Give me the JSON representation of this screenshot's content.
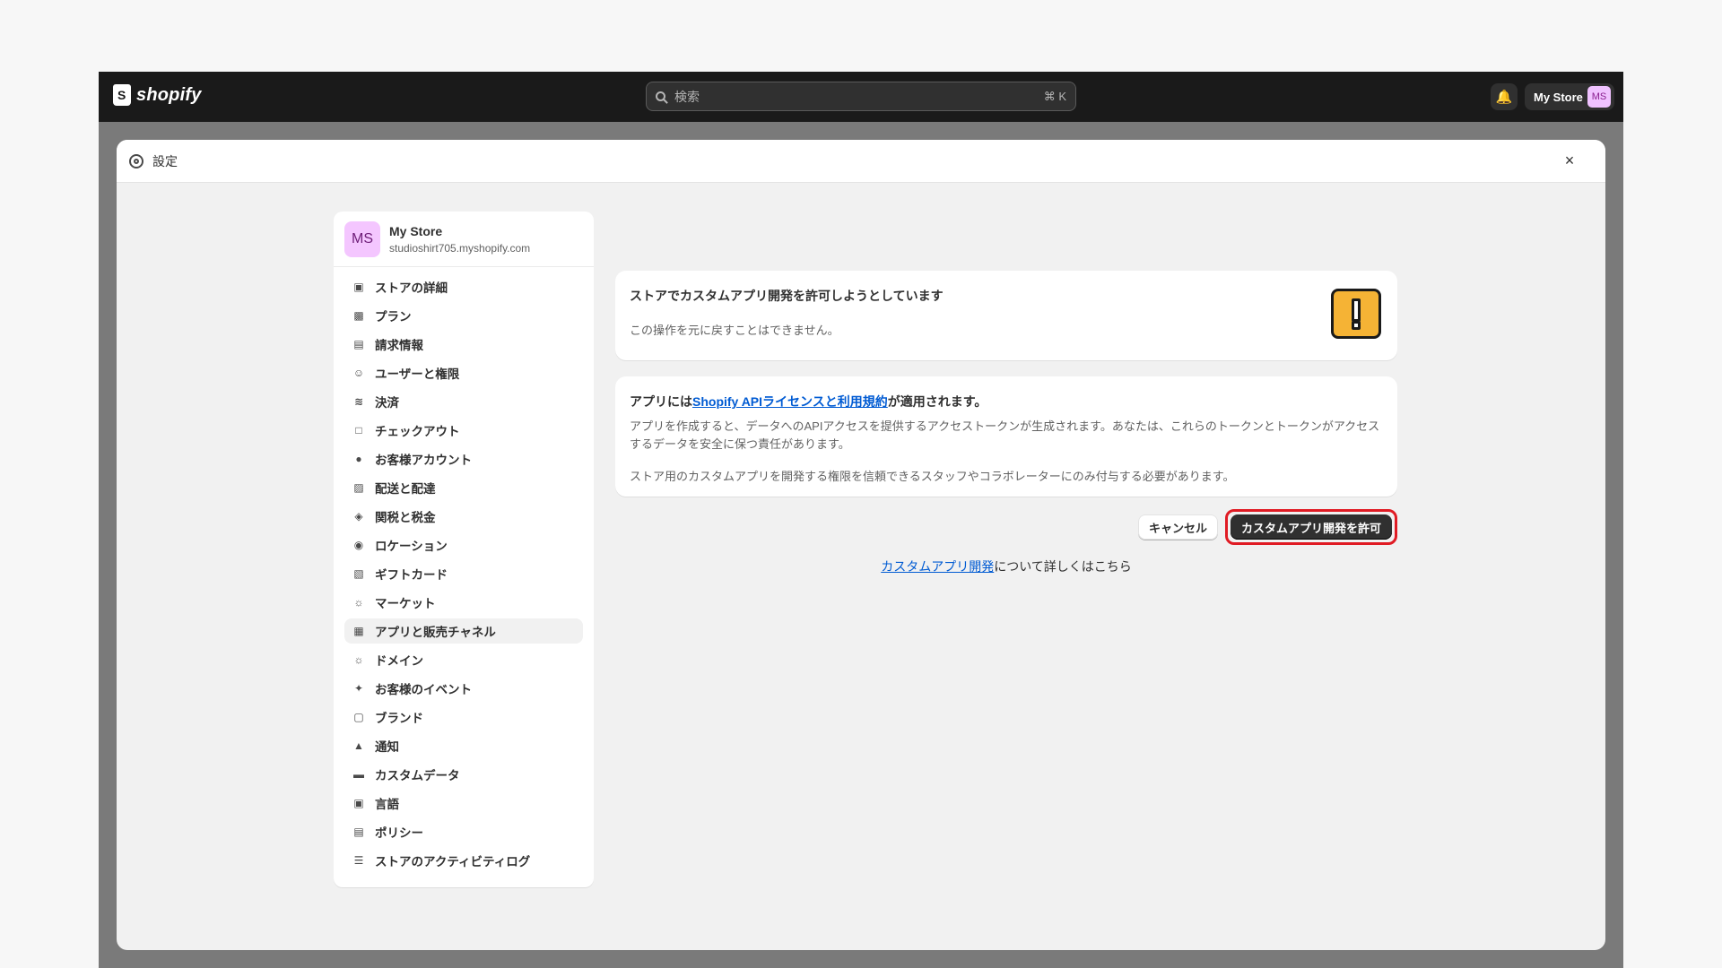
{
  "topbar": {
    "logo_text": "shopify",
    "search_placeholder": "検索",
    "search_shortcut": "⌘ K",
    "store_name": "My Store",
    "store_initials": "MS"
  },
  "modal": {
    "title": "設定",
    "close_label": "×"
  },
  "sidebar": {
    "store": {
      "initials": "MS",
      "name": "My Store",
      "domain": "studioshirt705.myshopify.com"
    },
    "items": [
      {
        "label": "ストアの詳細",
        "icon": "store-icon"
      },
      {
        "label": "プラン",
        "icon": "chart-icon"
      },
      {
        "label": "請求情報",
        "icon": "receipt-icon"
      },
      {
        "label": "ユーザーと権限",
        "icon": "user-lock-icon"
      },
      {
        "label": "決済",
        "icon": "payment-icon"
      },
      {
        "label": "チェックアウト",
        "icon": "cart-icon"
      },
      {
        "label": "お客様アカウント",
        "icon": "person-icon"
      },
      {
        "label": "配送と配達",
        "icon": "truck-icon"
      },
      {
        "label": "関税と税金",
        "icon": "tax-icon"
      },
      {
        "label": "ロケーション",
        "icon": "location-icon"
      },
      {
        "label": "ギフトカード",
        "icon": "gift-card-icon"
      },
      {
        "label": "マーケット",
        "icon": "globe-icon"
      },
      {
        "label": "アプリと販売チャネル",
        "icon": "apps-icon",
        "active": true
      },
      {
        "label": "ドメイン",
        "icon": "globe-icon"
      },
      {
        "label": "お客様のイベント",
        "icon": "cursor-icon"
      },
      {
        "label": "ブランド",
        "icon": "brand-icon"
      },
      {
        "label": "通知",
        "icon": "bell-icon"
      },
      {
        "label": "カスタムデータ",
        "icon": "database-icon"
      },
      {
        "label": "言語",
        "icon": "language-icon"
      },
      {
        "label": "ポリシー",
        "icon": "policy-icon"
      },
      {
        "label": "ストアのアクティビティログ",
        "icon": "list-icon"
      }
    ]
  },
  "warning_card": {
    "title": "ストアでカスタムアプリ開発を許可しようとしています",
    "subtitle": "この操作を元に戻すことはできません。"
  },
  "terms_card": {
    "head_prefix": "アプリには",
    "head_link": "Shopify APIライセンスと利用規約",
    "head_suffix": "が適用されます。",
    "paragraph1": "アプリを作成すると、データへのAPIアクセスを提供するアクセストークンが生成されます。あなたは、これらのトークンとトークンがアクセスするデータを安全に保つ責任があります。",
    "paragraph2": "ストア用のカスタムアプリを開発する権限を信頼できるスタッフやコラボレーターにのみ付与する必要があります。"
  },
  "actions": {
    "cancel_label": "キャンセル",
    "allow_label": "カスタムアプリ開発を許可"
  },
  "learn_more": {
    "link": "カスタムアプリ開発",
    "suffix": "について詳しくはこちら"
  },
  "colors": {
    "topbar": "#1a1a1a",
    "link": "#005bd3",
    "highlight": "#e01b24",
    "warning": "#f5b335"
  }
}
